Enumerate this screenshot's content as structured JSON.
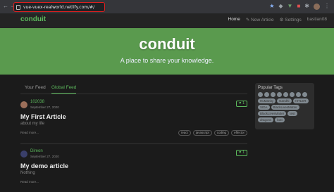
{
  "browser": {
    "url": "vue-vuex-realworld.netlify.com/#/",
    "nav_arrows": "← →"
  },
  "navbar": {
    "brand": "conduit",
    "links": [
      "Home",
      "New Article",
      "Settings",
      "bastian08"
    ]
  },
  "banner": {
    "title": "conduit",
    "subtitle": "A place to share your knowledge."
  },
  "tabs": [
    "Your Feed",
    "Global Feed"
  ],
  "articles": [
    {
      "author": "102038",
      "date": "September 27, 2020",
      "favorites": "1",
      "title": "My First Article",
      "description": "about my life",
      "read_more": "Read more...",
      "tags": [
        "react",
        "javascript",
        "coding",
        "effector"
      ]
    },
    {
      "author": "Direon",
      "date": "September 27, 2020",
      "favorites": "1",
      "title": "My demo article",
      "description": "Nothing",
      "read_more": "Read more..."
    }
  ],
  "sidebar": {
    "title": "Popular Tags",
    "tags": [
      "HuManity",
      "Gandhi",
      "HITLER",
      "SIDA",
      "BlackLivesMatter",
      "BlackLivesMatter",
      "test",
      "dragons",
      "butt"
    ]
  },
  "colors": {
    "accent": "#5cb85c",
    "banner": "#5a9a4e",
    "background": "#1b1b1b"
  }
}
